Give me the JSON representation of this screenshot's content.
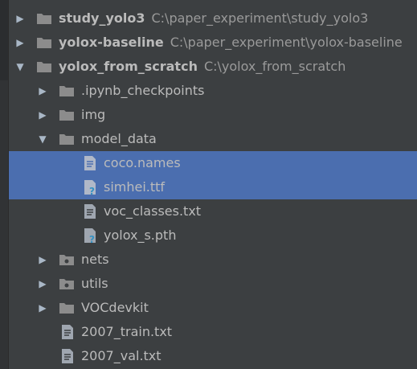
{
  "tree": {
    "items": [
      {
        "label": "study_yolo3",
        "path": "C:\\paper_experiment\\study_yolo3"
      },
      {
        "label": "yolox-baseline",
        "path": "C:\\paper_experiment\\yolox-baseline"
      },
      {
        "label": "yolox_from_scratch",
        "path": "C:\\yolox_from_scratch"
      },
      {
        "label": ".ipynb_checkpoints"
      },
      {
        "label": "img"
      },
      {
        "label": "model_data"
      },
      {
        "label": "coco.names"
      },
      {
        "label": "simhei.ttf"
      },
      {
        "label": "voc_classes.txt"
      },
      {
        "label": "yolox_s.pth"
      },
      {
        "label": "nets"
      },
      {
        "label": "utils"
      },
      {
        "label": "VOCdevkit"
      },
      {
        "label": "2007_train.txt"
      },
      {
        "label": "2007_val.txt"
      }
    ]
  },
  "colors": {
    "background": "#3c3f41",
    "selection": "#4b6eaf",
    "text": "#bbbbbb",
    "path_text": "#9a9a9a",
    "folder": "#8c8c8c"
  }
}
